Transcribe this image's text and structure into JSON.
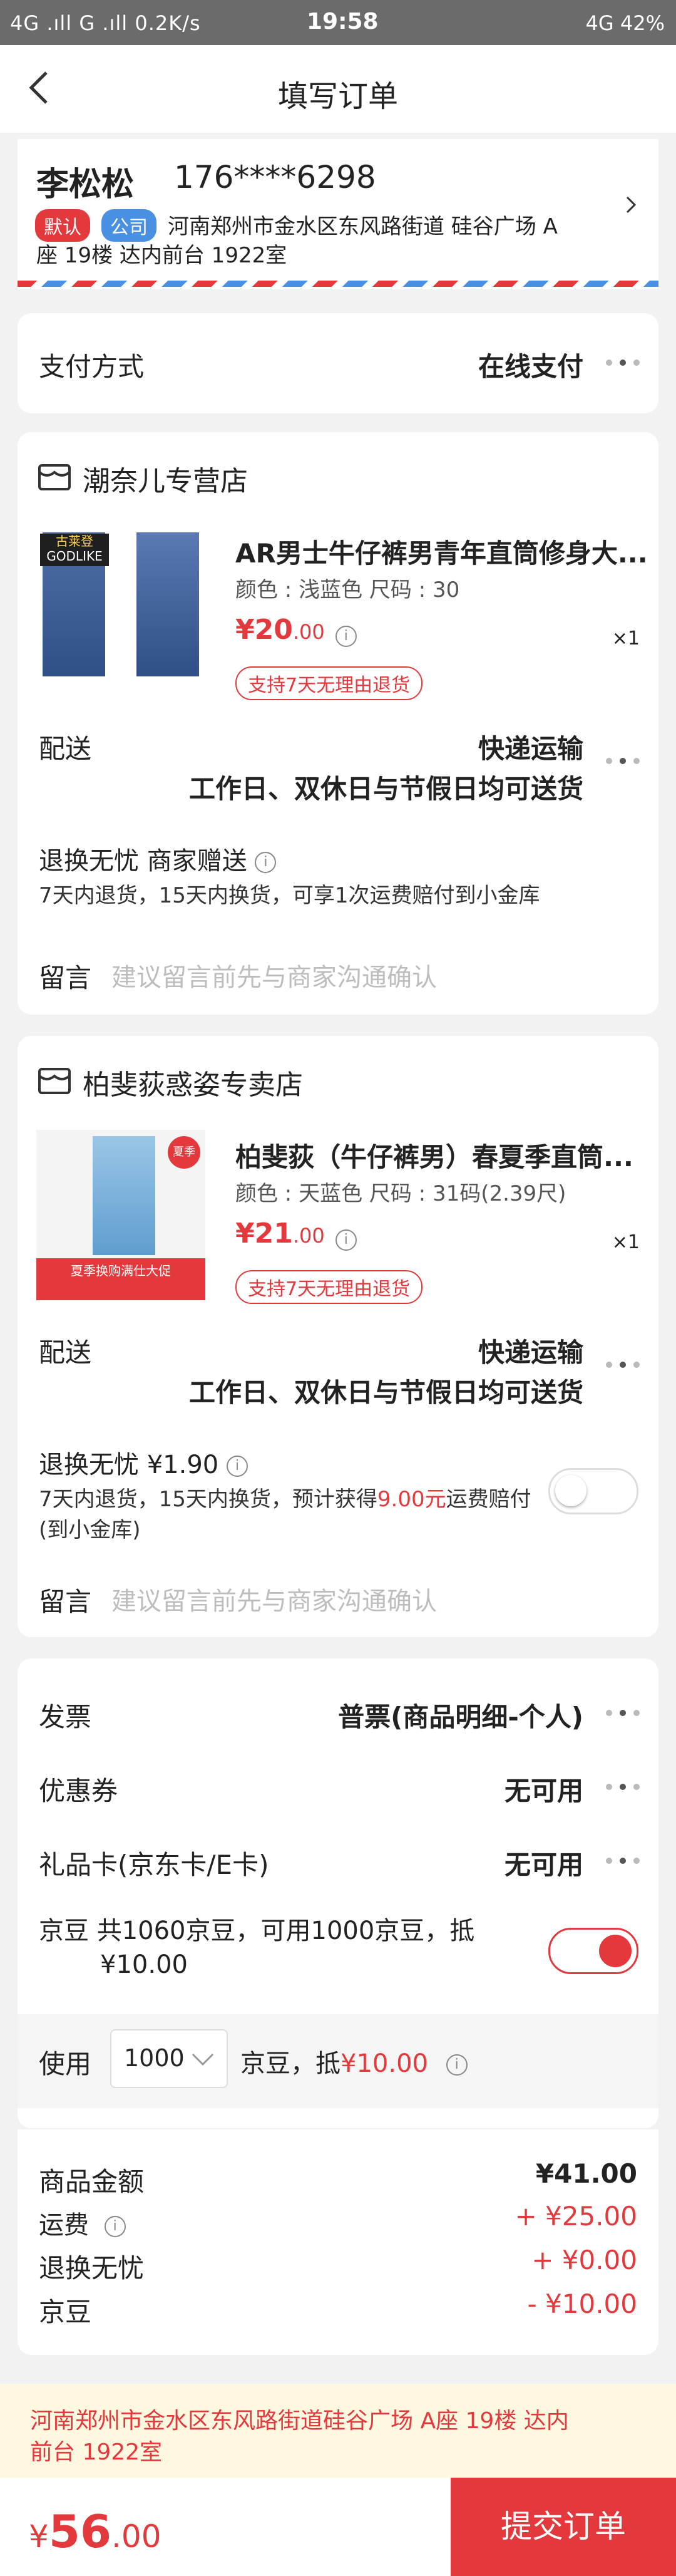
{
  "status_bar": {
    "left": "4G .ıll G .ıll 0.2K/s",
    "time": "19:58",
    "right": "4G 42%"
  },
  "nav": {
    "title": "填写订单"
  },
  "address": {
    "name": "李松松",
    "phone": "176****6298",
    "badge_default": "默认",
    "badge_company": "公司",
    "line": "河南郑州市金水区东风路街道 硅谷广场 A座 19楼 达内前台 1922室",
    "line_part1": "河南郑州市金水区东风路街道 硅谷广场 A",
    "line_part2": "座 19楼  达内前台  1922室"
  },
  "payment": {
    "label": "支付方式",
    "value": "在线支付"
  },
  "store1": {
    "name": "潮奈儿专营店",
    "product_title": "AR男士牛仔裤男青年直筒修身大...",
    "attrs": "颜色 : 浅蓝色   尺码 : 30",
    "price_int": "¥20",
    "price_dec": ".00",
    "qty": "×1",
    "return_tag": "支持7天无理由退货",
    "thumb_text1": "古莱登",
    "thumb_text2": "GODLIKE",
    "delivery_label": "配送",
    "delivery_value": "快递运输",
    "delivery_desc": "工作日、双休日与节假日均可送货",
    "warranty_title": "退换无忧 商家赠送",
    "warranty_desc": "7天内退货，15天内换货，可享1次运费赔付到小金库",
    "message_label": "留言",
    "message_placeholder": "建议留言前先与商家沟通确认"
  },
  "store2": {
    "name": "柏斐荻惑姿专卖店",
    "product_title": "柏斐荻（牛仔裤男）春夏季直筒...",
    "attrs": "颜色 : 天蓝色   尺码 : 31码(2.39尺)",
    "price_int": "¥21",
    "price_dec": ".00",
    "qty": "×1",
    "return_tag": "支持7天无理由退货",
    "thumb_badge": "夏季",
    "thumb_banner": "夏季换购满仕大促",
    "delivery_label": "配送",
    "delivery_value": "快递运输",
    "delivery_desc": "工作日、双休日与节假日均可送货",
    "warranty_title": "退换无忧 ¥1.90",
    "warranty_desc_a": "7天内退货，15天内换货，预计获得",
    "warranty_desc_amount": "9.00元",
    "warranty_desc_b": "运费赔付",
    "warranty_desc_c": "(到小金库)",
    "message_label": "留言",
    "message_placeholder": "建议留言前先与商家沟通确认"
  },
  "extras": {
    "invoice_label": "发票",
    "invoice_value": "普票(商品明细-个人)",
    "coupon_label": "优惠券",
    "coupon_value": "无可用",
    "giftcard_label": "礼品卡(京东卡/E卡)",
    "giftcard_value": "无可用",
    "jingdou_line1": "京豆 共1060京豆，可用1000京豆，抵",
    "jingdou_line2": "¥10.00",
    "use_label": "使用",
    "use_value": "1000",
    "use_suffix": "京豆，抵",
    "use_amount": "¥10.00"
  },
  "summary": {
    "goods_label": "商品金额",
    "goods_value": "¥41.00",
    "freight_label": "运费",
    "freight_value": "+ ¥25.00",
    "warranty_label": "退换无忧",
    "warranty_value": "+ ¥0.00",
    "jingdou_label": "京豆",
    "jingdou_value": "- ¥10.00"
  },
  "footer_address": "河南郑州市金水区东风路街道硅谷广场  A座  19楼   达内前台  1922室",
  "footer_address_1": "河南郑州市金水区东风路街道硅谷广场  A座  19楼   达内",
  "footer_address_2": "前台  1922室",
  "bottom": {
    "total_symbol": "¥",
    "total_int": "56",
    "total_dec": ".00",
    "submit_label": "提交订单"
  },
  "colors": {
    "accent": "#e4393c",
    "badge_blue": "#4a90e2",
    "address_bg": "#fff8e1"
  }
}
